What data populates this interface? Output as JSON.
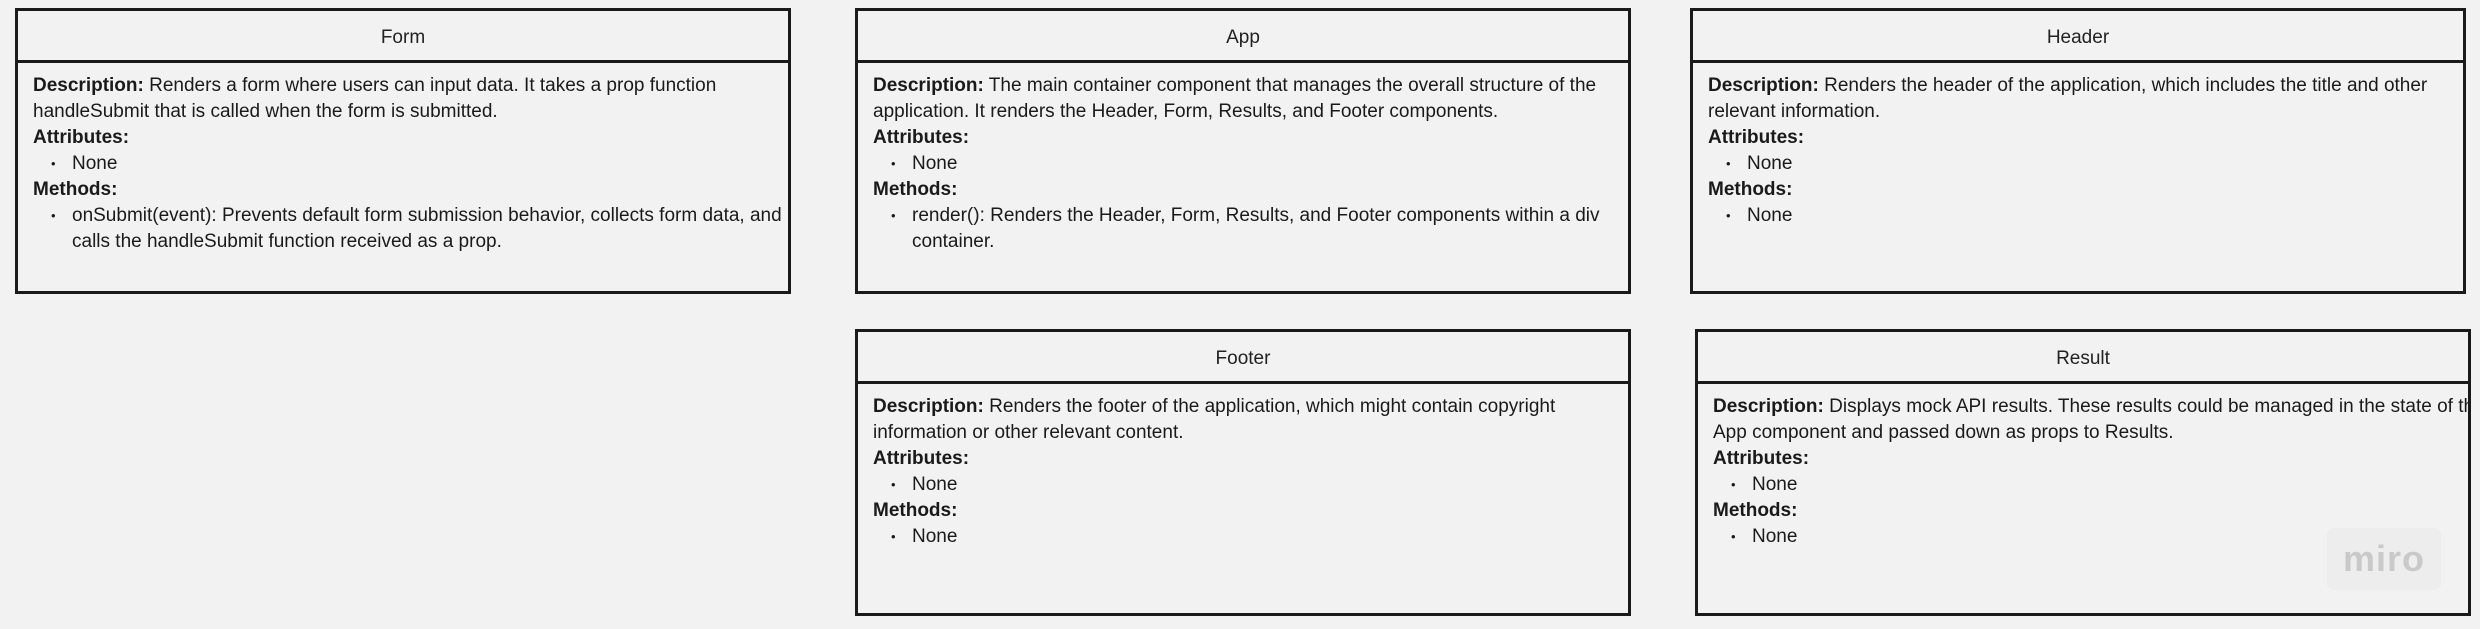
{
  "cards": {
    "form": {
      "title": "Form",
      "desc_label": "Description:",
      "desc_lines": [
        " Renders a form where users can input data. It takes a prop function",
        "handleSubmit that is called when the form is submitted."
      ],
      "attributes_label": "Attributes:",
      "attributes": [
        "None"
      ],
      "methods_label": "Methods:",
      "methods": [
        [
          "onSubmit(event): Prevents default form submission behavior, collects form data, and",
          "calls the handleSubmit function received as a prop."
        ]
      ]
    },
    "app": {
      "title": "App",
      "desc_label": "Description:",
      "desc_lines": [
        " The main container component that manages the overall structure of the",
        "application. It renders the Header, Form, Results, and Footer components."
      ],
      "attributes_label": "Attributes:",
      "attributes": [
        "None"
      ],
      "methods_label": "Methods:",
      "methods": [
        [
          "render(): Renders the Header, Form, Results, and Footer components within a div",
          "container."
        ]
      ]
    },
    "header": {
      "title": "Header",
      "desc_label": "Description:",
      "desc_lines": [
        " Renders the header of the application, which includes the title and other",
        "relevant information."
      ],
      "attributes_label": "Attributes:",
      "attributes": [
        "None"
      ],
      "methods_label": "Methods:",
      "methods": [
        [
          "None"
        ]
      ]
    },
    "footer": {
      "title": "Footer",
      "desc_label": "Description:",
      "desc_lines": [
        " Renders the footer of the application, which might contain copyright",
        "information or other relevant content."
      ],
      "attributes_label": "Attributes:",
      "attributes": [
        "None"
      ],
      "methods_label": "Methods:",
      "methods": [
        [
          "None"
        ]
      ]
    },
    "result": {
      "title": "Result",
      "desc_label": "Description:",
      "desc_lines": [
        " Displays mock API results. These results could be managed in the state of the",
        "App component and passed down as props to Results."
      ],
      "attributes_label": "Attributes:",
      "attributes": [
        "None"
      ],
      "methods_label": "Methods:",
      "methods": [
        [
          "None"
        ]
      ]
    }
  },
  "watermark": {
    "text": "miro"
  },
  "colors": {
    "background": "#f2f2f2",
    "border": "#1a1a1a",
    "watermark": "#c9c9c9"
  }
}
